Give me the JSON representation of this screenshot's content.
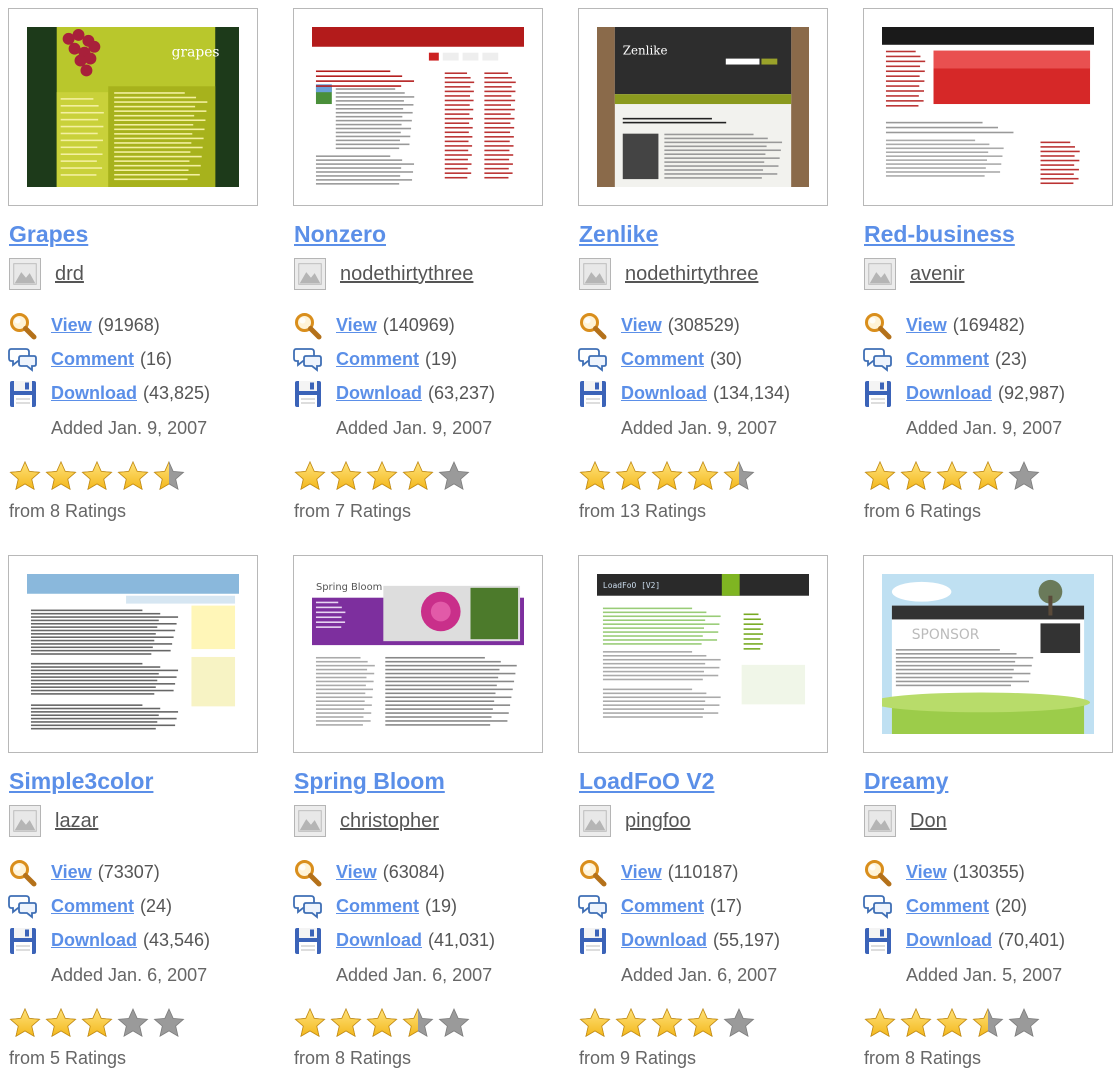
{
  "colors": {
    "link": "#5b8fe8",
    "text_muted": "#666666",
    "star_gold": "#f3b81d",
    "star_gray": "#9a9a9a"
  },
  "icons": {
    "avatar": "user-placeholder-icon",
    "view": "magnifier-icon",
    "comment": "speech-bubbles-icon",
    "download": "floppy-disk-icon",
    "star": "star-icon"
  },
  "labels": {
    "view": "View",
    "comment": "Comment",
    "download": "Download"
  },
  "templates": [
    {
      "title": "Grapes",
      "author": "drd",
      "views": "(91968)",
      "comments": "(16)",
      "downloads": "(43,825)",
      "added": "Added Jan. 9, 2007",
      "rating": 4.5,
      "ratings_text": "from 8 Ratings",
      "theme": "grapes"
    },
    {
      "title": "Nonzero",
      "author": "nodethirtythree",
      "views": "(140969)",
      "comments": "(19)",
      "downloads": "(63,237)",
      "added": "Added Jan. 9, 2007",
      "rating": 4,
      "ratings_text": "from 7 Ratings",
      "theme": "nonzero"
    },
    {
      "title": "Zenlike",
      "author": "nodethirtythree",
      "views": "(308529)",
      "comments": "(30)",
      "downloads": "(134,134)",
      "added": "Added Jan. 9, 2007",
      "rating": 4.5,
      "ratings_text": "from 13 Ratings",
      "theme": "zenlike"
    },
    {
      "title": "Red-business",
      "author": "avenir",
      "views": "(169482)",
      "comments": "(23)",
      "downloads": "(92,987)",
      "added": "Added Jan. 9, 2007",
      "rating": 4,
      "ratings_text": "from 6 Ratings",
      "theme": "redbusiness"
    },
    {
      "title": "Simple3color",
      "author": "lazar",
      "views": "(73307)",
      "comments": "(24)",
      "downloads": "(43,546)",
      "added": "Added Jan. 6, 2007",
      "rating": 3,
      "ratings_text": "from 5 Ratings",
      "theme": "simple3color"
    },
    {
      "title": "Spring Bloom",
      "author": "christopher",
      "views": "(63084)",
      "comments": "(19)",
      "downloads": "(41,031)",
      "added": "Added Jan. 6, 2007",
      "rating": 3.5,
      "ratings_text": "from 8 Ratings",
      "theme": "springbloom"
    },
    {
      "title": "LoadFoO V2",
      "author": "pingfoo",
      "views": "(110187)",
      "comments": "(17)",
      "downloads": "(55,197)",
      "added": "Added Jan. 6, 2007",
      "rating": 4,
      "ratings_text": "from 9 Ratings",
      "theme": "loadfoo"
    },
    {
      "title": "Dreamy",
      "author": "Don",
      "views": "(130355)",
      "comments": "(20)",
      "downloads": "(70,401)",
      "added": "Added Jan. 5, 2007",
      "rating": 3.5,
      "ratings_text": "from 8 Ratings",
      "theme": "dreamy"
    }
  ]
}
